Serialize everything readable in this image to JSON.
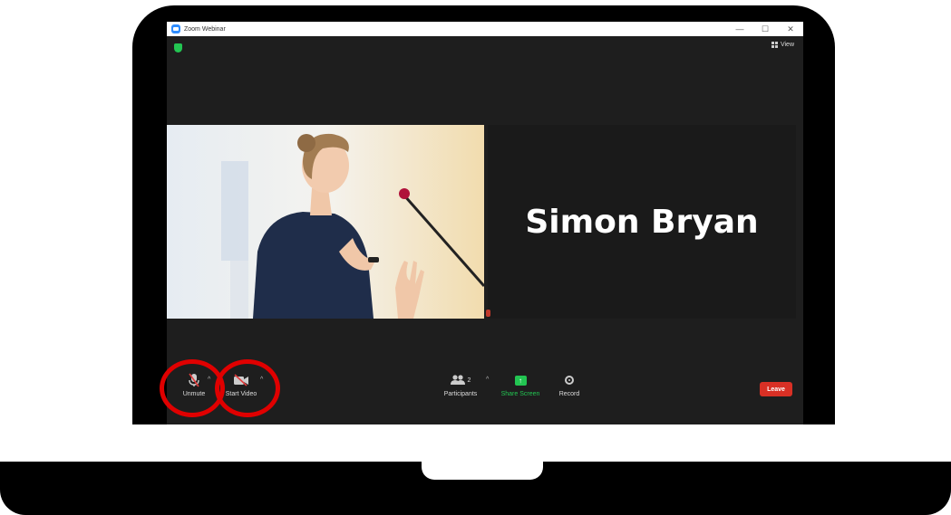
{
  "window": {
    "title": "Zoom Webinar",
    "controls": [
      "—",
      "☐",
      "✕"
    ]
  },
  "top_right": {
    "view_label": "View",
    "view_icon": "grid-icon"
  },
  "security_icon": "shield-icon",
  "tiles": {
    "photo_tile": {
      "description_icon": "speaker-photo"
    },
    "name_tile": {
      "name": "Simon Bryan"
    }
  },
  "toolbar": {
    "unmute_label": "Unmute",
    "start_video_label": "Start Video",
    "participants_label": "Participants",
    "participants_count": "2",
    "share_screen_label": "Share Screen",
    "record_label": "Record",
    "leave_label": "Leave",
    "caret": "^"
  },
  "colors": {
    "share_green": "#23c552",
    "leave_red": "#d93025",
    "highlight_red": "#e00000",
    "zoom_blue": "#2d8cff"
  }
}
